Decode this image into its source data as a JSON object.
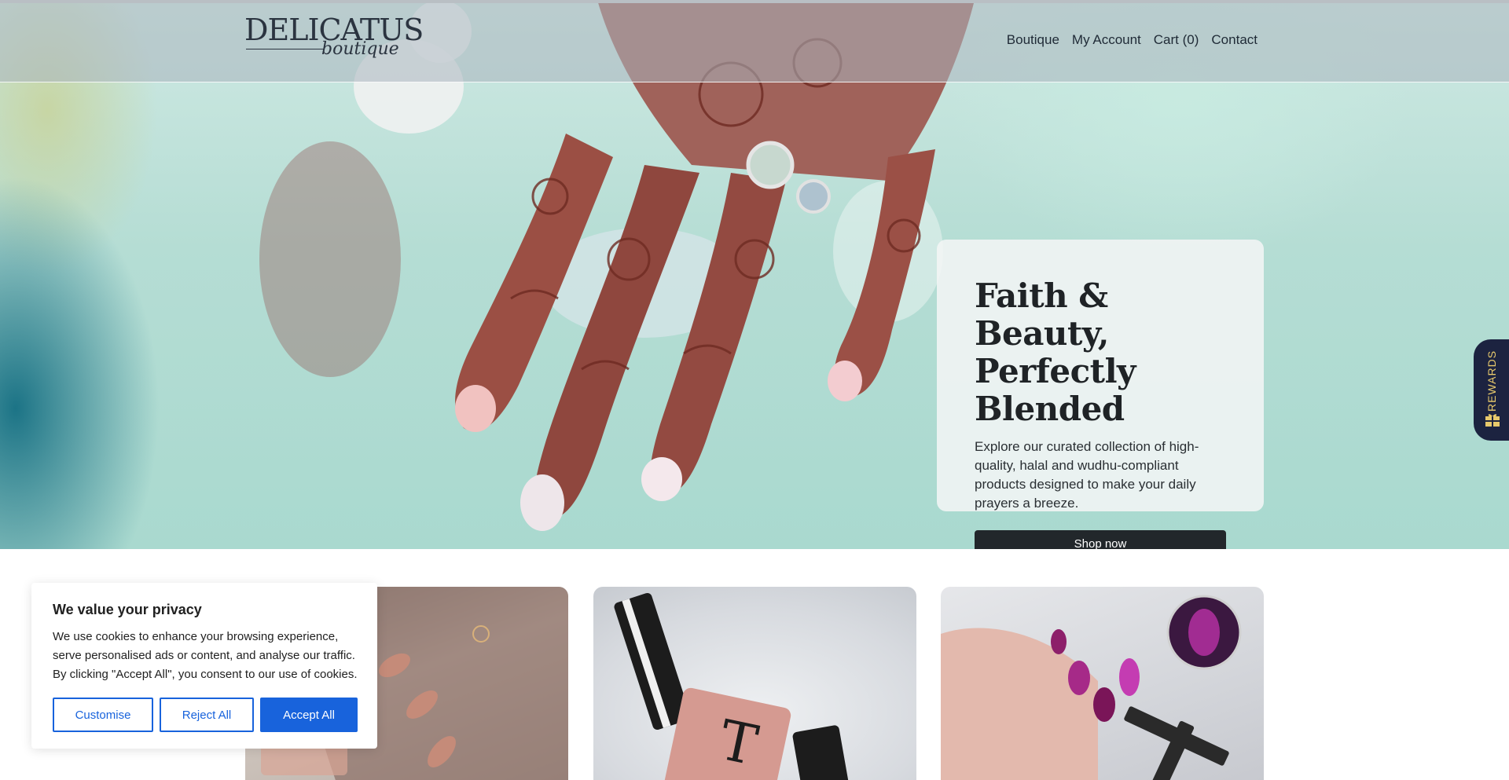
{
  "header": {
    "logo_main": "DELICATUS",
    "logo_script": "boutique",
    "nav": [
      "Boutique",
      "My Account",
      "Cart (0)",
      "Contact"
    ]
  },
  "hero": {
    "title_line1": "Faith & Beauty,",
    "title_line2": "Perfectly Blended",
    "text": "Explore our curated collection of high-quality, halal and wudhu-compliant products designed to make your daily prayers a breeze.",
    "cta": "Shop now"
  },
  "rewards": {
    "label": "REWARDS",
    "icon": "gift-icon",
    "background": "#1c2340",
    "text_color": "#e7c96c"
  },
  "products": [
    {
      "image": "glitter-nails-image"
    },
    {
      "image": "nail-polish-bottles-image"
    },
    {
      "image": "cat-eye-nails-image"
    }
  ],
  "cookie_banner": {
    "title": "We value your privacy",
    "text": "We use cookies to enhance your browsing experience, serve personalised ads or content, and analyse our traffic. By clicking \"Accept All\", you consent to our use of cookies.",
    "customise": "Customise",
    "reject_all": "Reject All",
    "accept_all": "Accept All",
    "accent": "#1863dc"
  }
}
